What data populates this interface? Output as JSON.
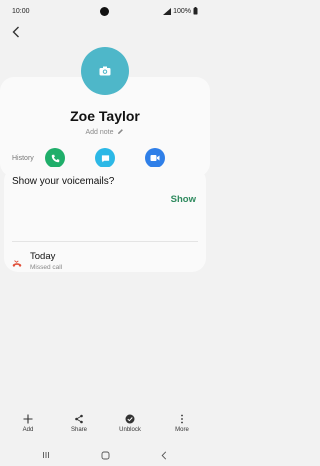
{
  "status_bar": {
    "time": "10:00",
    "battery": "100%"
  },
  "contact": {
    "name": "Zoe Taylor",
    "add_note": "Add note"
  },
  "history": {
    "label": "History",
    "voicemail_prompt": "Show your voicemails?",
    "voicemail_action": "Show",
    "entries": [
      {
        "date": "Today",
        "type": "Missed call"
      }
    ]
  },
  "bottom_bar": {
    "add": "Add",
    "share": "Share",
    "unblock": "Unblock",
    "more": "More"
  },
  "colors": {
    "avatar": "#4eb7c9",
    "call": "#1fae6a",
    "message": "#2cb8e6",
    "video": "#2f7fe8",
    "accent_green": "#2e8a5e",
    "missed": "#e0503a"
  }
}
